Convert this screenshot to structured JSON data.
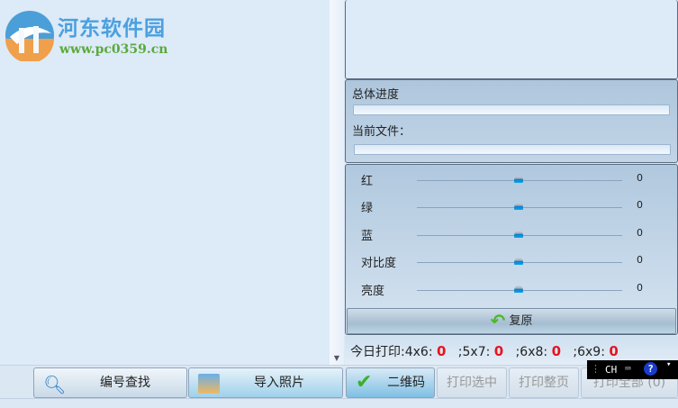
{
  "logo": {
    "title": "河东软件园",
    "url": "www.pc0359.cn"
  },
  "progress": {
    "overall_label": "总体进度",
    "overall_value": 0,
    "current_file_label": "当前文件：",
    "current_file_value": 0
  },
  "adjustments": [
    {
      "label": "红",
      "value": "0"
    },
    {
      "label": "绿",
      "value": "0"
    },
    {
      "label": "蓝",
      "value": "0"
    },
    {
      "label": "对比度",
      "value": "0"
    },
    {
      "label": "亮度",
      "value": "0"
    }
  ],
  "restore_label": "复原",
  "today": {
    "label": "今日打印:",
    "items": [
      {
        "label": "4x6:",
        "value": "0"
      },
      {
        "label": ";5x7:",
        "value": "0"
      },
      {
        "label": ";6x8:",
        "value": "0"
      },
      {
        "label": ";6x9:",
        "value": "0"
      }
    ]
  },
  "toolbar": {
    "search": "编号查找",
    "import": "导入照片",
    "qrcode": "二维码",
    "print_selected": "打印选中",
    "print_page": "打印整页",
    "print_all": "打印全部 (0)"
  },
  "ime": {
    "lang": "CH"
  }
}
